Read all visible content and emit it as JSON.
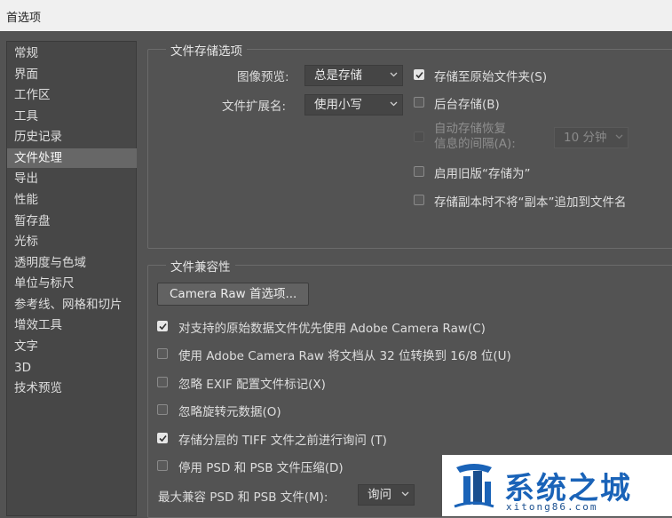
{
  "window": {
    "title": "首选项"
  },
  "sidebar": {
    "items": [
      {
        "label": "常规"
      },
      {
        "label": "界面"
      },
      {
        "label": "工作区"
      },
      {
        "label": "工具"
      },
      {
        "label": "历史记录"
      },
      {
        "label": "文件处理",
        "selected": true
      },
      {
        "label": "导出"
      },
      {
        "label": "性能"
      },
      {
        "label": "暂存盘"
      },
      {
        "label": "光标"
      },
      {
        "label": "透明度与色域"
      },
      {
        "label": "单位与标尺"
      },
      {
        "label": "参考线、网格和切片"
      },
      {
        "label": "增效工具"
      },
      {
        "label": "文字"
      },
      {
        "label": "3D"
      },
      {
        "label": "技术预览"
      }
    ]
  },
  "file_save_options": {
    "title": "文件存储选项",
    "image_preview_label": "图像预览:",
    "image_preview_value": "总是存储",
    "file_extension_label": "文件扩展名:",
    "file_extension_value": "使用小写",
    "save_to_original_folder": {
      "label": "存储至原始文件夹(S)",
      "checked": true
    },
    "background_save": {
      "label": "后台存储(B)",
      "checked": false
    },
    "auto_save": {
      "label_line1": "自动存储恢复",
      "label_line2": "信息的间隔(A):",
      "checked": false,
      "disabled": true
    },
    "auto_save_interval_value": "10 分钟",
    "legacy_save_as": {
      "label": "启用旧版“存储为”",
      "checked": false
    },
    "no_copy_suffix": {
      "label": "存储副本时不将“副本”追加到文件名",
      "checked": false
    }
  },
  "file_compatibility": {
    "title": "文件兼容性",
    "camera_raw_button": "Camera Raw 首选项...",
    "prefer_camera_raw": {
      "label": "对支持的原始数据文件优先使用 Adobe Camera Raw(C)",
      "checked": true
    },
    "convert_32_to_16": {
      "label": "使用 Adobe Camera Raw 将文档从 32 位转换到 16/8 位(U)",
      "checked": false
    },
    "ignore_exif": {
      "label": "忽略 EXIF 配置文件标记(X)",
      "checked": false
    },
    "ignore_rotation": {
      "label": "忽略旋转元数据(O)",
      "checked": false
    },
    "ask_layered_tiff": {
      "label": "存储分层的 TIFF 文件之前进行询问 (T)",
      "checked": true
    },
    "disable_psd_compression": {
      "label": "停用 PSD 和 PSB 文件压缩(D)",
      "checked": false
    },
    "max_compat_label": "最大兼容 PSD 和 PSB 文件(M):",
    "max_compat_value": "询问"
  },
  "watermark": {
    "text": "系统之城",
    "url": "xitong86.com"
  },
  "colors": {
    "panel_bg": "#535353",
    "sidebar_bg": "#474747",
    "selected_bg": "#676767",
    "watermark_blue": "#1a63b8"
  }
}
